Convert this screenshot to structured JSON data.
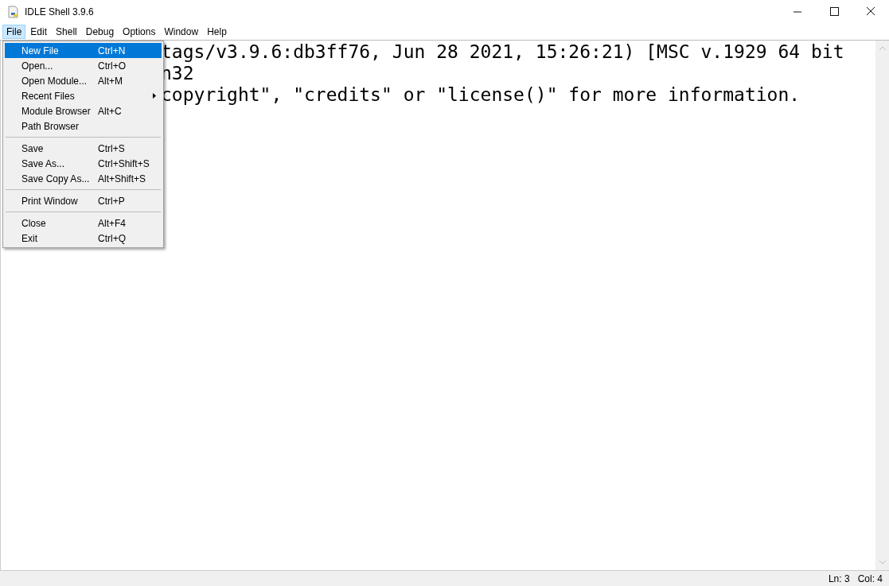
{
  "window": {
    "title": "IDLE Shell 3.9.6"
  },
  "menubar": [
    {
      "label": "File",
      "selected": true
    },
    {
      "label": "Edit",
      "selected": false
    },
    {
      "label": "Shell",
      "selected": false
    },
    {
      "label": "Debug",
      "selected": false
    },
    {
      "label": "Options",
      "selected": false
    },
    {
      "label": "Window",
      "selected": false
    },
    {
      "label": "Help",
      "selected": false
    }
  ],
  "shell_lines": [
    "tags/v3.9.6:db3ff76, Jun 28 2021, 15:26:21) [MSC v.1929 64 bit",
    "n32",
    "copyright\", \"credits\" or \"license()\" for more information."
  ],
  "file_menu": [
    {
      "kind": "item",
      "label": "New File",
      "shortcut": "Ctrl+N",
      "selected": true,
      "submenu": false
    },
    {
      "kind": "item",
      "label": "Open...",
      "shortcut": "Ctrl+O",
      "selected": false,
      "submenu": false
    },
    {
      "kind": "item",
      "label": "Open Module...",
      "shortcut": "Alt+M",
      "selected": false,
      "submenu": false
    },
    {
      "kind": "item",
      "label": "Recent Files",
      "selected": false,
      "submenu": true
    },
    {
      "kind": "item",
      "label": "Module Browser",
      "shortcut": "Alt+C",
      "selected": false,
      "submenu": false
    },
    {
      "kind": "item",
      "label": "Path Browser",
      "selected": false,
      "submenu": false
    },
    {
      "kind": "separator"
    },
    {
      "kind": "item",
      "label": "Save",
      "shortcut": "Ctrl+S",
      "selected": false,
      "submenu": false
    },
    {
      "kind": "item",
      "label": "Save As...",
      "shortcut": "Ctrl+Shift+S",
      "selected": false,
      "submenu": false
    },
    {
      "kind": "item",
      "label": "Save Copy As...",
      "shortcut": "Alt+Shift+S",
      "selected": false,
      "submenu": false
    },
    {
      "kind": "separator"
    },
    {
      "kind": "item",
      "label": "Print Window",
      "shortcut": "Ctrl+P",
      "selected": false,
      "submenu": false
    },
    {
      "kind": "separator"
    },
    {
      "kind": "item",
      "label": "Close",
      "shortcut": "Alt+F4",
      "selected": false,
      "submenu": false
    },
    {
      "kind": "item",
      "label": "Exit",
      "shortcut": "Ctrl+Q",
      "selected": false,
      "submenu": false
    }
  ],
  "status_bar": {
    "line": "Ln: 3",
    "column": "Col: 4"
  }
}
